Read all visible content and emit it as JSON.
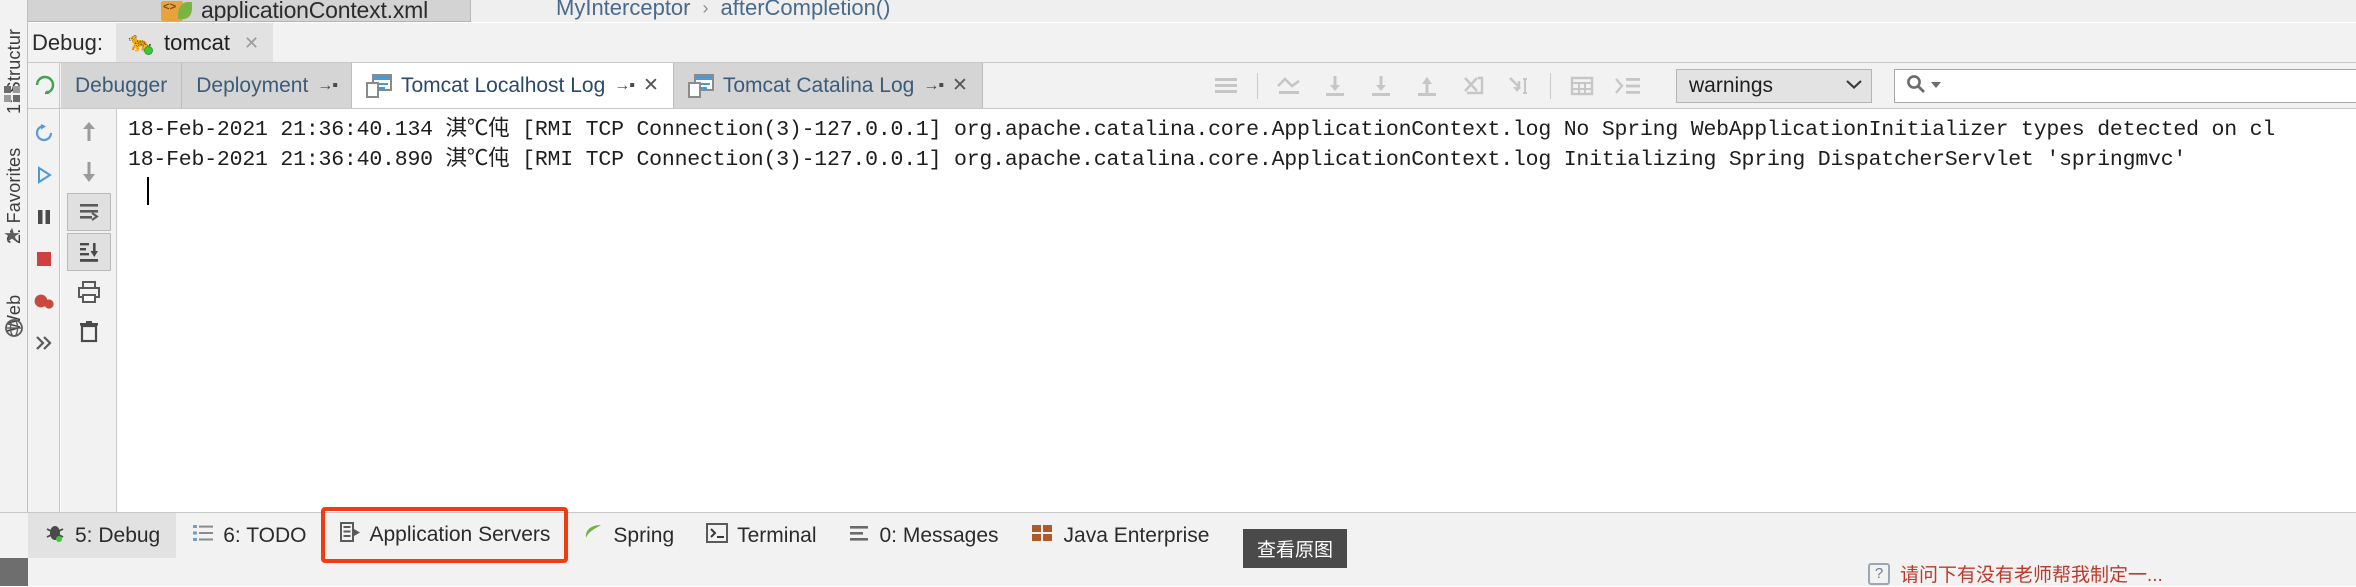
{
  "window": {
    "editor_tab_title": "applicationContext.xml",
    "editor_tab_icon": "xml-file-icon"
  },
  "breadcrumb": {
    "items": [
      {
        "label": "MyInterceptor",
        "icon": "class-icon"
      },
      {
        "label": "afterCompletion()",
        "icon": "method-icon"
      }
    ],
    "separator": "›"
  },
  "debug_header": {
    "label": "Debug:",
    "run_config": {
      "name": "tomcat",
      "icon": "tomcat-icon",
      "status_icon": "green-run-dot",
      "close_icon": "close-icon",
      "close_glyph": "✕"
    }
  },
  "console_toolbar": {
    "rerun_icon": "rerun-icon",
    "tabs": [
      {
        "id": "debugger",
        "label": "Debugger",
        "active": false,
        "pin": "",
        "closable": false,
        "icon": ""
      },
      {
        "id": "deployment",
        "label": "Deployment",
        "active": false,
        "pin": "→▪",
        "closable": false,
        "icon": ""
      },
      {
        "id": "tomcat-localhost-log",
        "label": "Tomcat Localhost Log",
        "active": true,
        "pin": "→▪",
        "closable": true,
        "icon": "log-window-icon",
        "close_glyph": "✕"
      },
      {
        "id": "tomcat-catalina-log",
        "label": "Tomcat Catalina Log",
        "active": false,
        "pin": "→▪",
        "closable": true,
        "icon": "log-window-icon",
        "close_glyph": "✕"
      }
    ],
    "icons": [
      {
        "name": "soft-wrap-icon",
        "title": "Soft-Wrap"
      },
      {
        "name": "scroll-to-top-icon",
        "title": "Scroll to Top"
      },
      {
        "name": "scroll-down-icon",
        "title": "Scroll Down"
      },
      {
        "name": "scroll-to-end-icon",
        "title": "Scroll to End"
      },
      {
        "name": "scroll-up-icon",
        "title": "Scroll Up"
      },
      {
        "name": "clear-all-icon",
        "title": "Clear All"
      },
      {
        "name": "print-selected-icon",
        "title": "Print"
      },
      {
        "name": "table-view-icon",
        "title": "Table"
      },
      {
        "name": "group-lines-icon",
        "title": "Group"
      }
    ],
    "filter": {
      "value": "warnings",
      "chevron_icon": "chevron-down-icon"
    },
    "search": {
      "value": "",
      "placeholder": "",
      "icon": "search-icon",
      "dropdown_icon": "search-dropdown-caret"
    }
  },
  "console_gutter": {
    "buttons": [
      {
        "name": "restart-icon",
        "glyph": "⟳"
      },
      {
        "name": "resume-program-icon",
        "glyph": "▶"
      },
      {
        "name": "pause-program-icon",
        "glyph": "❙❙"
      },
      {
        "name": "stop-icon",
        "glyph": "■"
      },
      {
        "name": "view-breakpoints-icon",
        "glyph": "●"
      },
      {
        "name": "expand-more-icon",
        "glyph": "»"
      }
    ]
  },
  "console_side": {
    "buttons": [
      {
        "name": "scroll-up-arrow-icon",
        "glyph": "↑"
      },
      {
        "name": "scroll-down-arrow-icon",
        "glyph": "↓"
      },
      {
        "name": "soft-wrap-toggle-icon",
        "glyph": "⇥"
      },
      {
        "name": "scroll-to-end-toggle-icon",
        "glyph": "↓≡",
        "active": true
      },
      {
        "name": "print-icon",
        "glyph": "🖨"
      },
      {
        "name": "delete-icon",
        "glyph": "🗑"
      }
    ]
  },
  "console": {
    "lines": [
      "18-Feb-2021 21:36:40.134 淇℃伅 [RMI TCP Connection(3)-127.0.0.1] org.apache.catalina.core.ApplicationContext.log No Spring WebApplicationInitializer types detected on cl",
      "18-Feb-2021 21:36:40.890 淇℃伅 [RMI TCP Connection(3)-127.0.0.1] org.apache.catalina.core.ApplicationContext.log Initializing Spring DispatcherServlet 'springmvc'"
    ]
  },
  "bottom_bar": {
    "items": [
      {
        "id": "debug",
        "label": "5: Debug",
        "mnemonic": "5",
        "icon": "bug-icon",
        "selected": true,
        "highlighted": false
      },
      {
        "id": "todo",
        "label": "6: TODO",
        "mnemonic": "6",
        "icon": "todo-list-icon",
        "selected": false,
        "highlighted": false
      },
      {
        "id": "application-servers",
        "label": "Application Servers",
        "mnemonic": "",
        "icon": "server-icon",
        "selected": false,
        "highlighted": true
      },
      {
        "id": "spring",
        "label": "Spring",
        "mnemonic": "",
        "icon": "spring-leaf-icon",
        "selected": false,
        "highlighted": false
      },
      {
        "id": "terminal",
        "label": "Terminal",
        "mnemonic": "",
        "icon": "terminal-icon",
        "selected": false,
        "highlighted": false
      },
      {
        "id": "messages",
        "label": "0: Messages",
        "mnemonic": "0",
        "icon": "messages-icon",
        "selected": false,
        "highlighted": false
      },
      {
        "id": "java-enterprise",
        "label": "Java Enterprise",
        "mnemonic": "",
        "icon": "java-enterprise-icon",
        "selected": false,
        "highlighted": false
      }
    ],
    "highlight_color": "#f03c13"
  },
  "left_strip": {
    "tabs": [
      {
        "id": "structure",
        "label": "1: Structur",
        "mnemonic": "1"
      },
      {
        "id": "favorites",
        "label": "2: Favorites",
        "mnemonic": "2"
      },
      {
        "id": "web",
        "label": "Web",
        "mnemonic": ""
      }
    ],
    "icons": [
      {
        "name": "grid-squares-icon"
      },
      {
        "name": "star-icon"
      },
      {
        "name": "globe-icon"
      }
    ]
  },
  "overlay": {
    "tooltip_label": "查看原图",
    "status_question_icon": "help-icon",
    "status_question_text": "请问下有没有老师帮我制定一..."
  }
}
